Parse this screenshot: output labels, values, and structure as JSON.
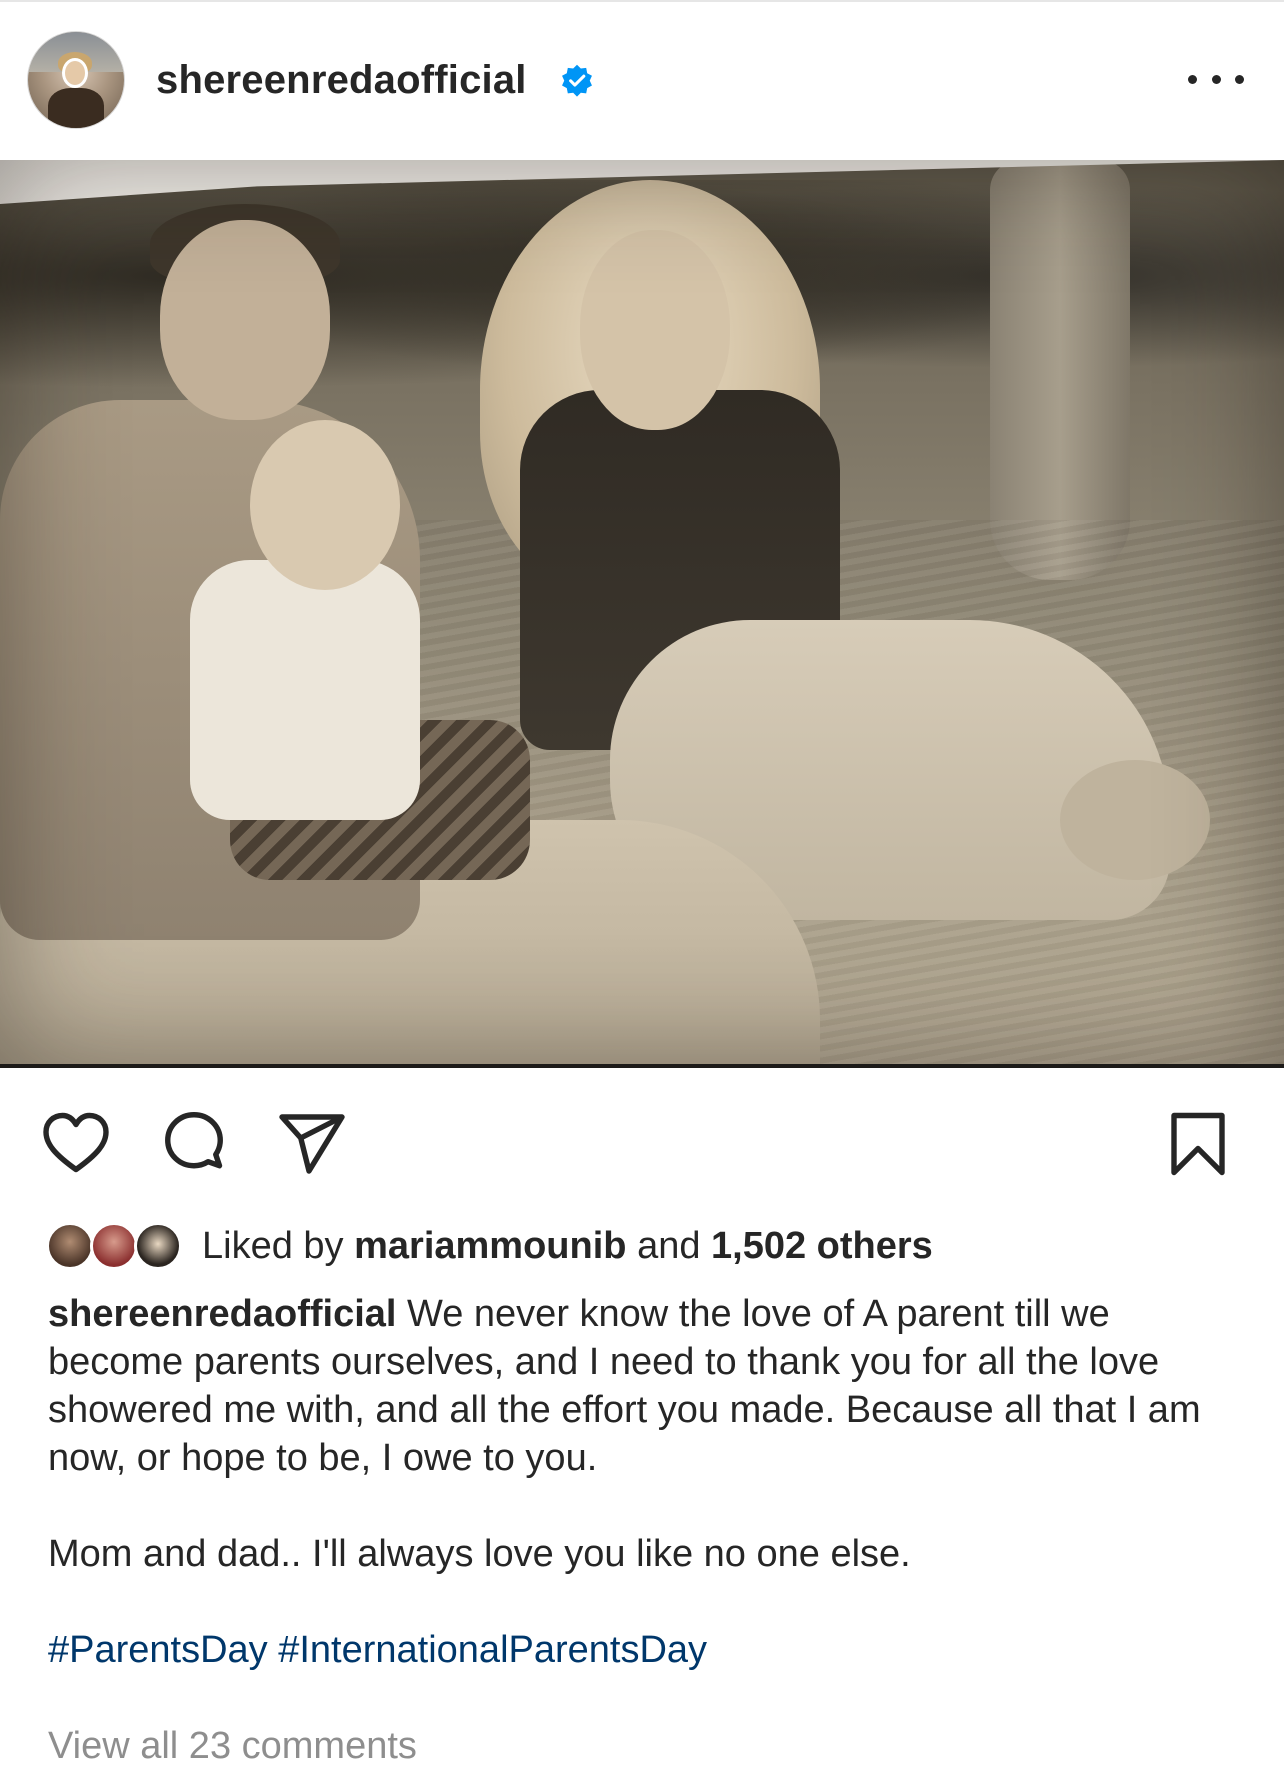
{
  "post": {
    "username": "shereenredaofficial",
    "verified": true,
    "avatar_icon": "profile-avatar",
    "more_icon": "more-horizontal-icon"
  },
  "actions": {
    "icons": [
      "heart-icon",
      "comment-icon",
      "share-icon",
      "bookmark-icon"
    ]
  },
  "likes": {
    "prefix": "Liked by",
    "user": "mariammounib",
    "connector": "and",
    "others": "1,502 others"
  },
  "caption": {
    "username": "shereenredaofficial",
    "text": "We never know the love of A parent till we become parents ourselves, and I need to thank you for all the love showered me with, and all the effort you made. Because all that I am now, or hope to be, I owe to you.",
    "line2": "Mom and dad.. I'll always love you like no one else.",
    "hashtags": "#ParentsDay #InternationalParentsDay"
  },
  "comments": {
    "view_all": "View all 23 comments"
  },
  "colors": {
    "text": "#262626",
    "verified_blue": "#0095f6",
    "hashtag": "#00376b",
    "muted": "#8e8e8e"
  }
}
